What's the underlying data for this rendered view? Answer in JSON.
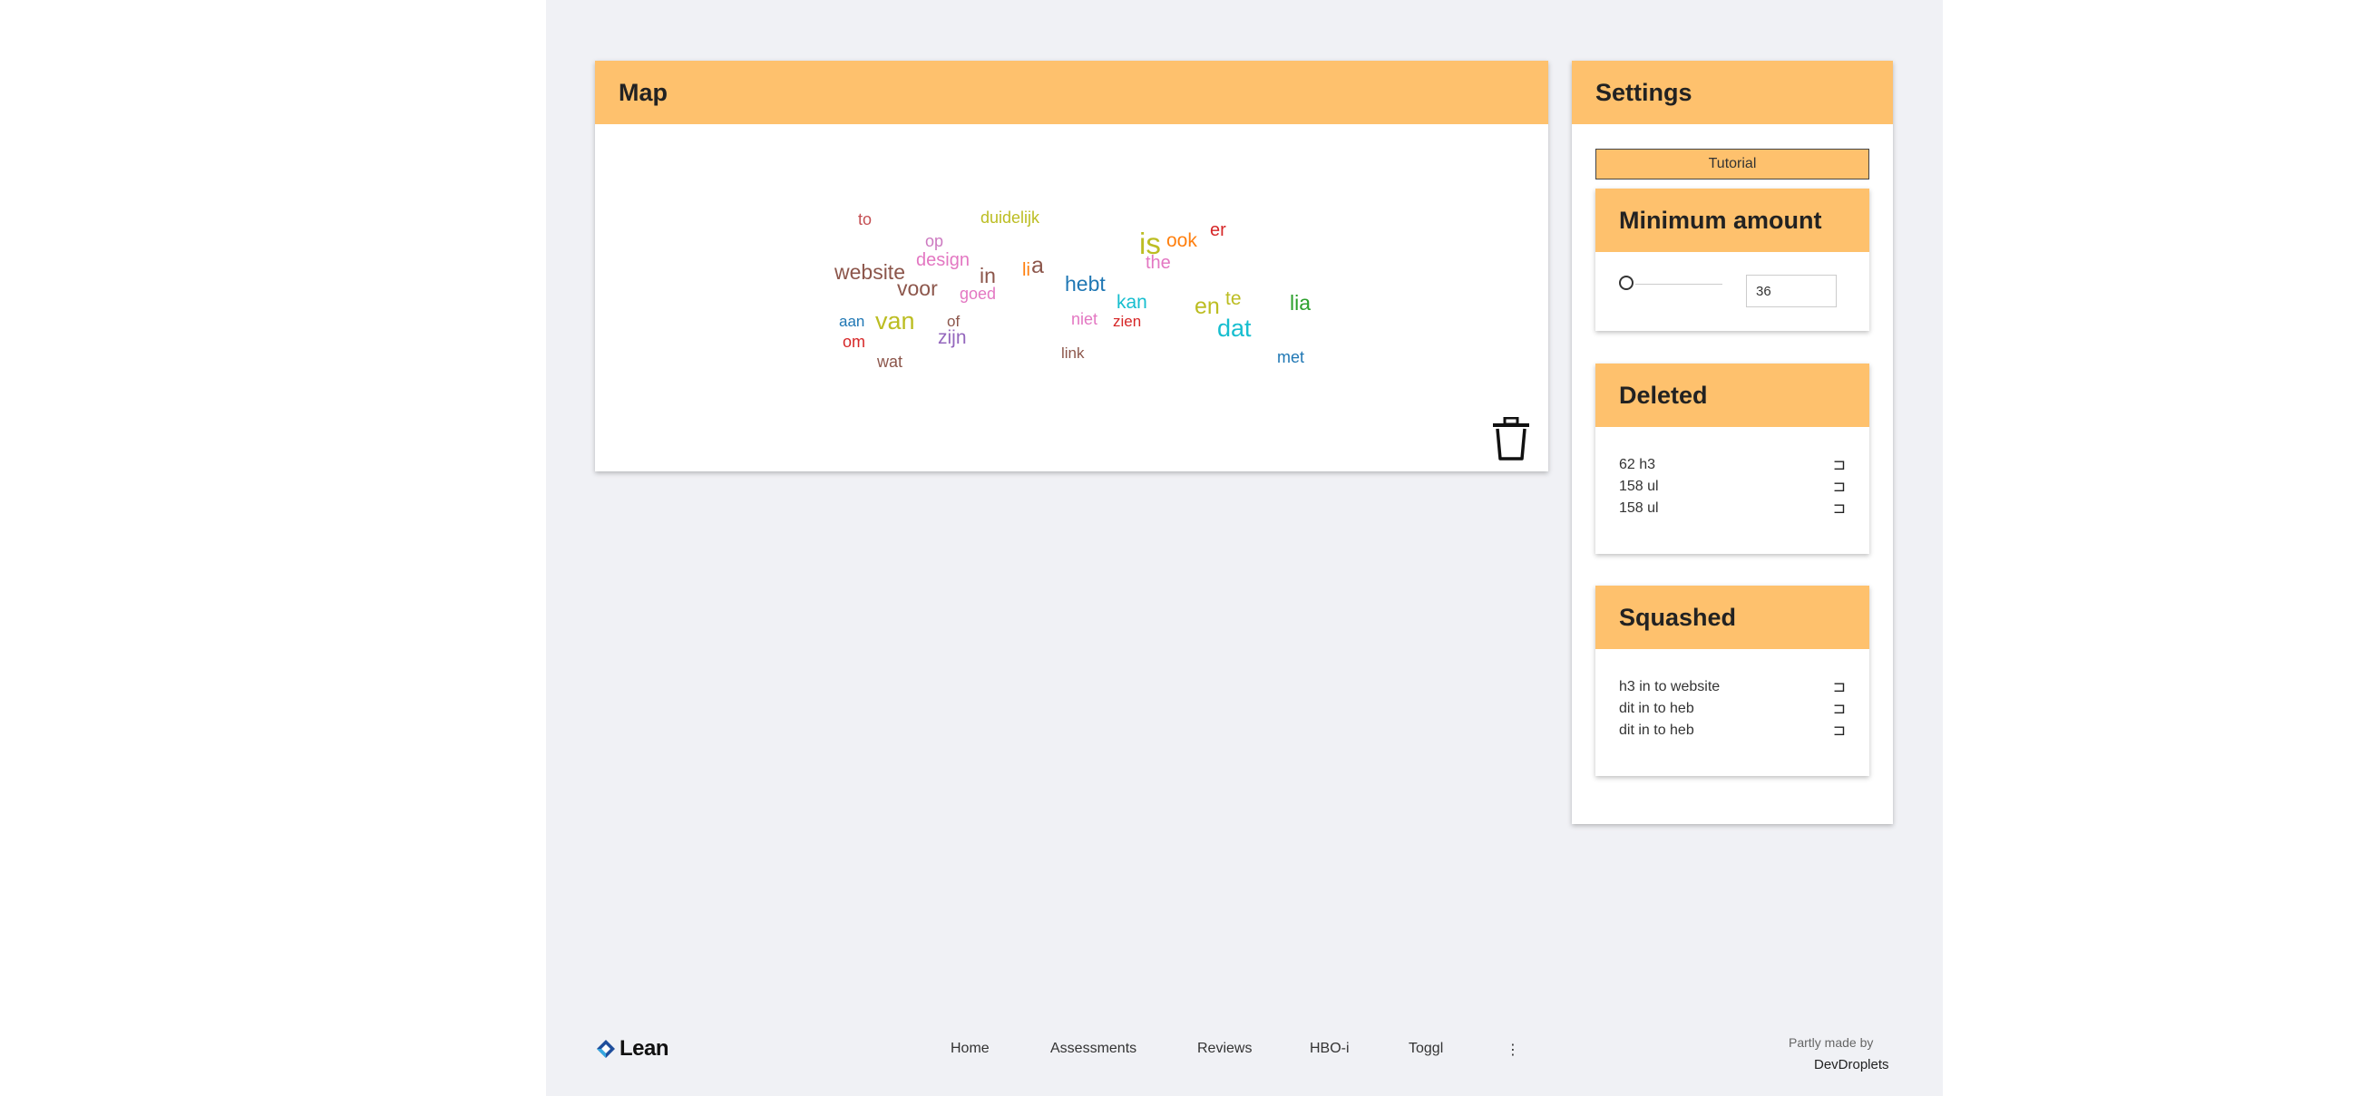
{
  "map": {
    "title": "Map",
    "words": [
      {
        "text": "to",
        "color": "#c44e52",
        "size": 18
      },
      {
        "text": "duidelijk",
        "color": "#bcbd22",
        "size": 18
      },
      {
        "text": "op",
        "color": "#cc79c0",
        "size": 18
      },
      {
        "text": "design",
        "color": "#e377c2",
        "size": 20
      },
      {
        "text": "website",
        "color": "#8c564b",
        "size": 23
      },
      {
        "text": "voor",
        "color": "#8c564b",
        "size": 23
      },
      {
        "text": "in",
        "color": "#8c564b",
        "size": 23
      },
      {
        "text": "li",
        "color": "#ff7f0e",
        "size": 20
      },
      {
        "text": "a",
        "color": "#8c564b",
        "size": 25
      },
      {
        "text": "goed",
        "color": "#e377c2",
        "size": 18
      },
      {
        "text": "is",
        "color": "#bcbd22",
        "size": 33
      },
      {
        "text": "ook",
        "color": "#ff7f0e",
        "size": 21
      },
      {
        "text": "er",
        "color": "#d62728",
        "size": 20
      },
      {
        "text": "the",
        "color": "#e377c2",
        "size": 20
      },
      {
        "text": "hebt",
        "color": "#1f77b4",
        "size": 23
      },
      {
        "text": "kan",
        "color": "#17becf",
        "size": 21
      },
      {
        "text": "en",
        "color": "#bcbd22",
        "size": 25
      },
      {
        "text": "te",
        "color": "#bcbd22",
        "size": 21
      },
      {
        "text": "lia",
        "color": "#2ca02c",
        "size": 23
      },
      {
        "text": "aan",
        "color": "#1f77b4",
        "size": 17
      },
      {
        "text": "van",
        "color": "#bcbd22",
        "size": 27
      },
      {
        "text": "of",
        "color": "#8c564b",
        "size": 17
      },
      {
        "text": "niet",
        "color": "#e377c2",
        "size": 18
      },
      {
        "text": "zien",
        "color": "#d62728",
        "size": 17
      },
      {
        "text": "dat",
        "color": "#17becf",
        "size": 27
      },
      {
        "text": "om",
        "color": "#d62728",
        "size": 18
      },
      {
        "text": "zijn",
        "color": "#9467bd",
        "size": 21
      },
      {
        "text": "link",
        "color": "#8c564b",
        "size": 17
      },
      {
        "text": "wat",
        "color": "#8c564b",
        "size": 18
      },
      {
        "text": "met",
        "color": "#1f77b4",
        "size": 18
      }
    ]
  },
  "settings": {
    "title": "Settings",
    "tutorial_label": "Tutorial",
    "minimum": {
      "title": "Minimum amount",
      "value": "36",
      "slider_value": 0
    },
    "deleted": {
      "title": "Deleted",
      "items": [
        "62 h3",
        "158 ul",
        "158 ul"
      ]
    },
    "squashed": {
      "title": "Squashed",
      "items": [
        "h3 in to website",
        "dit in to heb",
        "dit in to heb"
      ]
    },
    "restore_icon": "restore-icon"
  },
  "footer": {
    "logo_text": "Lean",
    "nav": [
      "Home",
      "Assessments",
      "Reviews",
      "HBO-i",
      "Toggl",
      "⋮"
    ],
    "credit_line1": "Partly made by",
    "credit_line2": "DevDroplets"
  }
}
